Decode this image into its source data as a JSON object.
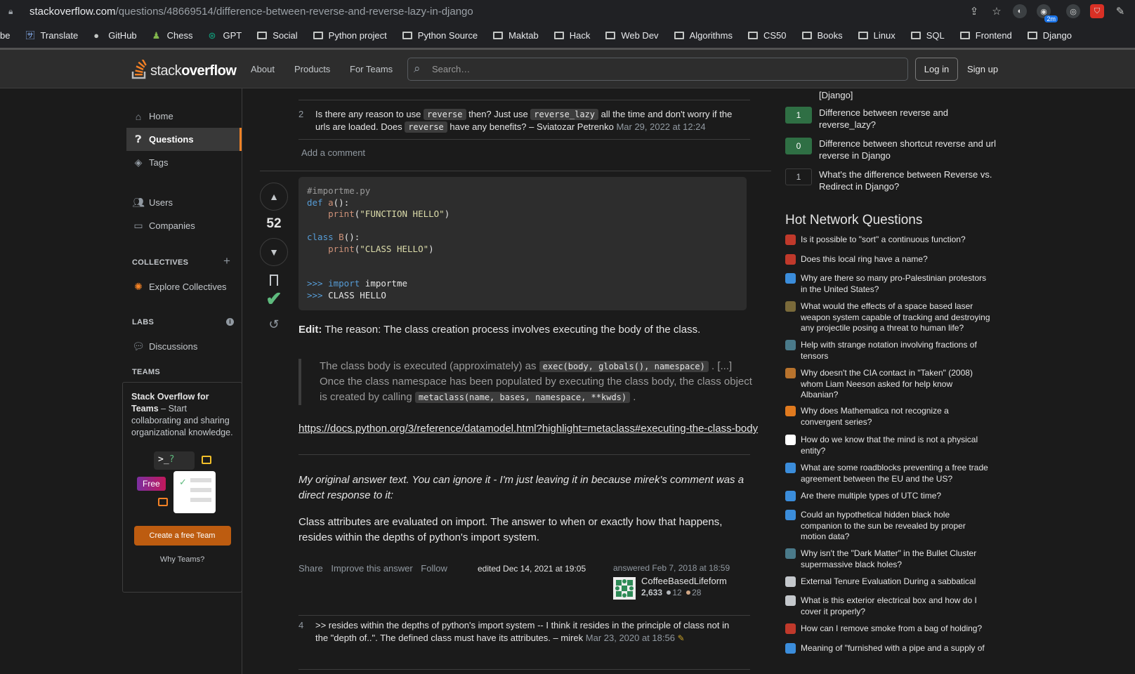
{
  "browser": {
    "url_host": "stackoverflow.com",
    "url_path": "/questions/48669514/difference-between-reverse-and-reverse-lazy-in-django",
    "ext_badge": "2m",
    "bookmarks": [
      {
        "label": "be",
        "type": "text"
      },
      {
        "label": "Translate",
        "type": "translate"
      },
      {
        "label": "GitHub",
        "type": "github"
      },
      {
        "label": "Chess",
        "type": "chess"
      },
      {
        "label": "GPT",
        "type": "gpt"
      },
      {
        "label": "Social",
        "type": "folder"
      },
      {
        "label": "Python project",
        "type": "folder"
      },
      {
        "label": "Python Source",
        "type": "folder"
      },
      {
        "label": "Maktab",
        "type": "folder"
      },
      {
        "label": "Hack",
        "type": "folder"
      },
      {
        "label": "Web Dev",
        "type": "folder"
      },
      {
        "label": "Algorithms",
        "type": "folder"
      },
      {
        "label": "CS50",
        "type": "folder"
      },
      {
        "label": "Books",
        "type": "folder"
      },
      {
        "label": "Linux",
        "type": "folder"
      },
      {
        "label": "SQL",
        "type": "folder"
      },
      {
        "label": "Frontend",
        "type": "folder"
      },
      {
        "label": "Django",
        "type": "folder"
      }
    ]
  },
  "header": {
    "logo_stack": "stack",
    "logo_overflow": "overflow",
    "about": "About",
    "products": "Products",
    "for_teams": "For Teams",
    "search_placeholder": "Search…",
    "login": "Log in",
    "signup": "Sign up"
  },
  "sidebar": {
    "home": "Home",
    "questions": "Questions",
    "tags": "Tags",
    "users": "Users",
    "companies": "Companies",
    "collectives_title": "COLLECTIVES",
    "explore_collectives": "Explore Collectives",
    "labs_title": "LABS",
    "discussions": "Discussions",
    "teams_title": "TEAMS",
    "teams_heading": "Stack Overflow for Teams",
    "teams_text": " – Start collaborating and sharing organizational knowledge.",
    "free_badge": "Free",
    "create_team": "Create a free Team",
    "why_teams": "Why Teams?"
  },
  "top_comment": {
    "votes": "2",
    "text_before": "Is there any reason to use ",
    "code1": "reverse",
    "text_mid1": " then? Just use ",
    "code2": "reverse_lazy",
    "text_mid2": " all the time and don't worry if the urls are loaded. Does ",
    "code3": "reverse",
    "text_after": " have any benefits? – ",
    "author": "Sviatozar Petrenko",
    "date": "Mar 29, 2022 at 12:24",
    "add_comment": "Add a comment"
  },
  "answer": {
    "score": "52",
    "code": {
      "comment": "#importme.py",
      "def_kw": "def",
      "func_a": "a",
      "print1": "print",
      "str1": "\"FUNCTION HELLO\"",
      "class_kw": "class",
      "class_b": "B",
      "print2": "print",
      "str2": "\"CLASS HELLO\"",
      "prompt1": ">>>",
      "import_kw": "import",
      "module": "importme",
      "prompt2": ">>>",
      "output": "CLASS HELLO"
    },
    "edit_label": "Edit:",
    "edit_text": " The reason: The class creation process involves executing the body of the class.",
    "quote_before": "The class body is executed (approximately) as ",
    "quote_code1": "exec(body, globals(), namespace)",
    "quote_mid": " . [...] Once the class namespace has been populated by executing the class body, the class object is created by calling ",
    "quote_code2": "metaclass(name, bases, namespace, **kwds)",
    "quote_end": " .",
    "link": "https://docs.python.org/3/reference/datamodel.html?highlight=metaclass#executing-the-class-body",
    "italic_text": "My original answer text. You can ignore it - I'm just leaving it in because mirek's comment was a direct response to it:",
    "body_text": "Class attributes are evaluated on import. The answer to when or exactly how that happens, resides within the depths of python's import system.",
    "share": "Share",
    "improve": "Improve this answer",
    "follow": "Follow",
    "edited": "edited Dec 14, 2021 at 19:05",
    "answered": "answered Feb 7, 2018 at 18:59",
    "user": "CoffeeBasedLifeform",
    "rep": "2,633",
    "silver": "12",
    "bronze": "28"
  },
  "bottom_comment": {
    "votes": "4",
    "text": ">> resides within the depths of python's import system -- I think it resides in the principle of class not in the \"depth of..\". The defined class must have its attributes. – ",
    "author": "mirek",
    "date": "Mar 23, 2020 at 18:56"
  },
  "related": {
    "top_fragment": "[Django]",
    "items": [
      {
        "score": "1",
        "title": "Difference between reverse and reverse_lazy?",
        "answered": true
      },
      {
        "score": "0",
        "title": "Difference between shortcut reverse and url reverse in Django",
        "answered": true
      },
      {
        "score": "1",
        "title": "What's the difference between Reverse vs. Redirect in Django?",
        "answered": false
      }
    ]
  },
  "hot": {
    "title": "Hot Network Questions",
    "items": [
      "Is it possible to \"sort\" a continuous function?",
      "Does this local ring have a name?",
      "Why are there so many pro-Palestinian protestors in the United States?",
      "What would the effects of a space based laser weapon system capable of tracking and destroying any projectile posing a threat to human life?",
      "Help with strange notation involving fractions of tensors",
      "Why doesn't the CIA contact in \"Taken\" (2008) whom Liam Neeson asked for help know Albanian?",
      "Why does Mathematica not recognize a convergent series?",
      "How do we know that the mind is not a physical entity?",
      "What are some roadblocks preventing a free trade agreement between the EU and the US?",
      "Are there multiple types of UTC time?",
      "Could an hypothetical hidden black hole companion to the sun be revealed by proper motion data?",
      "Why isn't the \"Dark Matter\" in the Bullet Cluster supermassive black holes?",
      "External Tenure Evaluation During a sabbatical",
      "What is this exterior electrical box and how do I cover it properly?",
      "How can I remove smoke from a bag of holding?",
      "Meaning of \"furnished with a pipe and a supply of"
    ]
  }
}
